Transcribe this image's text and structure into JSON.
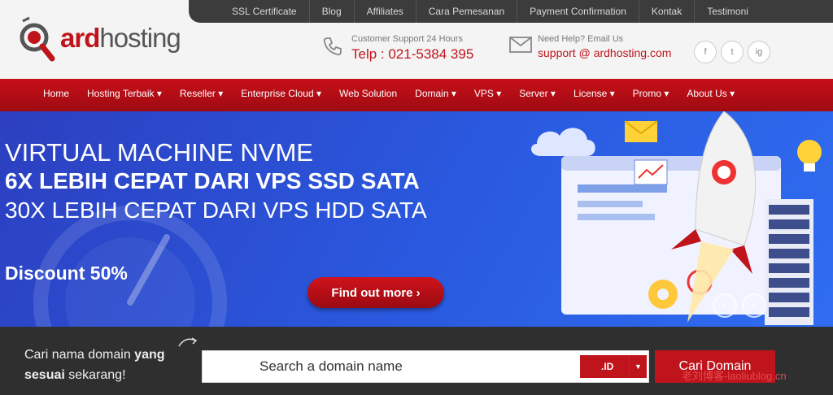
{
  "topbar": {
    "links": [
      "SSL Certificate",
      "Blog",
      "Affiliates",
      "Cara Pemesanan",
      "Payment Confirmation",
      "Kontak",
      "Testimoni"
    ]
  },
  "logo": {
    "part1": "ard",
    "part2": "hosting"
  },
  "support": {
    "label": "Customer Support 24 Hours",
    "phone": "Telp : 021-5384 395"
  },
  "email": {
    "label": "Need Help? Email Us",
    "address": "support @ ardhosting.com"
  },
  "social": [
    "f",
    "t",
    "ig"
  ],
  "nav": {
    "items": [
      "Home",
      "Hosting Terbaik ▾",
      "Reseller ▾",
      "Enterprise Cloud ▾",
      "Web Solution",
      "Domain ▾",
      "VPS ▾",
      "Server ▾",
      "License ▾",
      "Promo ▾",
      "About Us ▾"
    ]
  },
  "hero": {
    "line1": "VIRTUAL MACHINE NVME",
    "line2": "6X LEBIH CEPAT DARI VPS SSD SATA",
    "line3": "30X LEBIH CEPAT DARI VPS HDD SATA",
    "discount": "Discount 50%",
    "cta": "Find out more ›",
    "prev": "‹",
    "next": "›"
  },
  "search": {
    "prompt_part1": "Cari nama domain ",
    "prompt_bold1": "yang",
    "prompt_bold2": "sesuai",
    "prompt_part2": " sekarang!",
    "placeholder": "Search a domain name",
    "tld": ".ID",
    "button": "Cari Domain"
  },
  "watermark": "老刘博客-laoliublog.cn",
  "colors": {
    "brand_red": "#c0141c",
    "hero_blue": "#2a5ae0",
    "dark": "#2f2f2f"
  }
}
